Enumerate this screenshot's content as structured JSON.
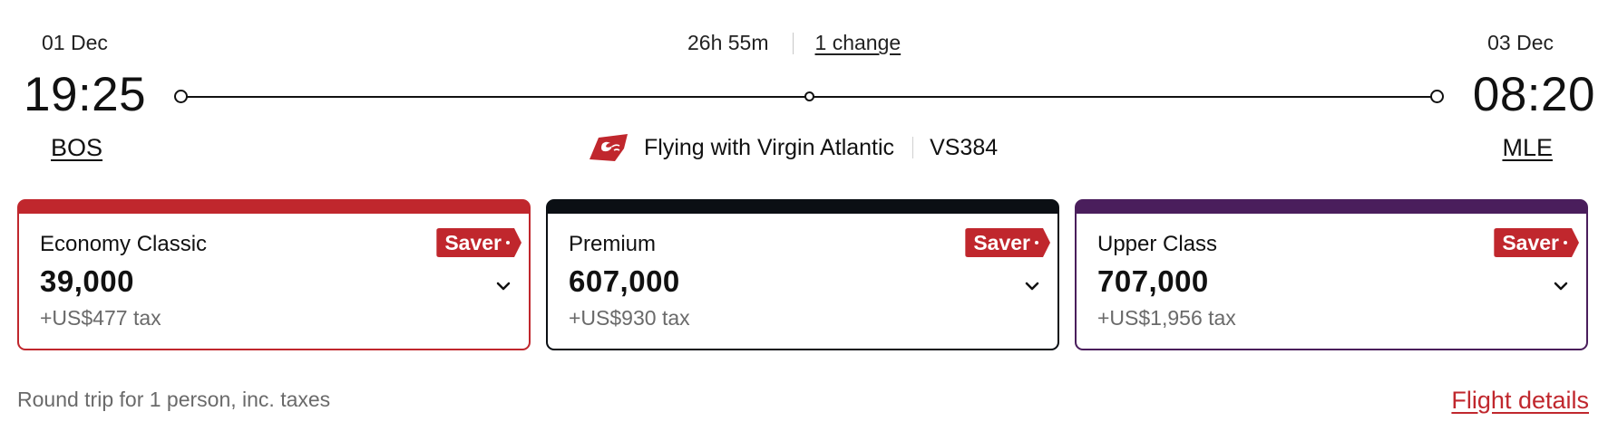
{
  "departure": {
    "date": "01 Dec",
    "time": "19:25",
    "airport": "BOS"
  },
  "arrival": {
    "date": "03 Dec",
    "time": "08:20",
    "airport": "MLE"
  },
  "journey": {
    "duration": "26h 55m",
    "changes": "1 change"
  },
  "operator": {
    "label": "Flying with Virgin Atlantic",
    "flight_number": "VS384",
    "logo_icon": "virgin-logo-icon",
    "logo_color": "#c0272d"
  },
  "fares": [
    {
      "cabin": "Economy Classic",
      "points": "39,000",
      "tax": "+US$477 tax",
      "badge": "Saver",
      "accent": "#c0272d"
    },
    {
      "cabin": "Premium",
      "points": "607,000",
      "tax": "+US$930 tax",
      "badge": "Saver",
      "accent": "#0b0f14"
    },
    {
      "cabin": "Upper Class",
      "points": "707,000",
      "tax": "+US$1,956 tax",
      "badge": "Saver",
      "accent": "#4a1e5c"
    }
  ],
  "footer": {
    "note": "Round trip for 1 person, inc. taxes",
    "details_link": "Flight details"
  },
  "colors": {
    "brand_red": "#c0272d",
    "muted_text": "#6a6a6a"
  }
}
